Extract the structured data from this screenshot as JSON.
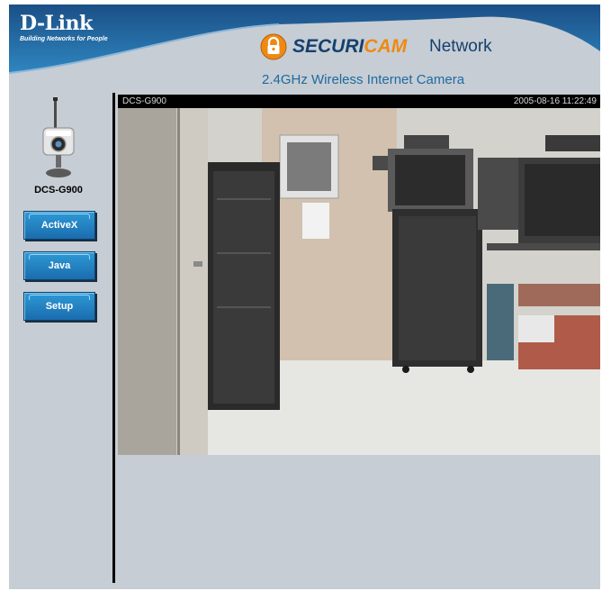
{
  "header": {
    "brand_name": "D-Link",
    "brand_tagline": "Building Networks for People",
    "product_name_part1": "SECURI",
    "product_name_part2": "CAM",
    "product_name_suffix": "Network",
    "subtitle": "2.4GHz Wireless Internet Camera"
  },
  "sidebar": {
    "model": "DCS-G900",
    "buttons": {
      "activex": "ActiveX",
      "java": "Java",
      "setup": "Setup"
    }
  },
  "video": {
    "overlay_label": "DCS-G900",
    "timestamp": "2005-08-16 11:22:49"
  },
  "colors": {
    "page_background": "#c6cdd4",
    "header_blue": "#1e5d92",
    "button_blue": "#1a7cc1",
    "brand_orange": "#ee8a14"
  }
}
